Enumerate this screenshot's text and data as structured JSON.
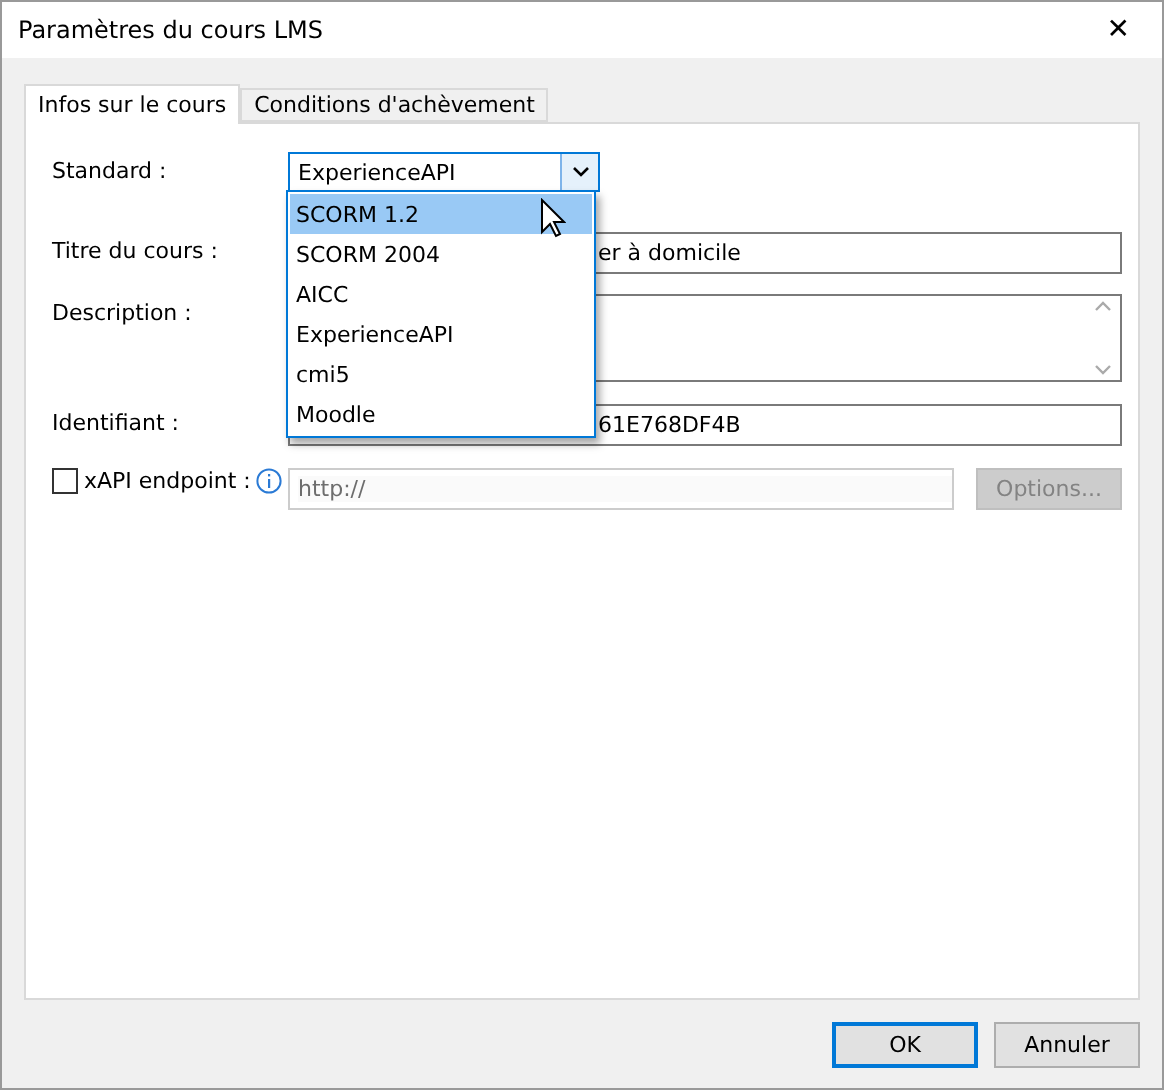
{
  "window": {
    "title": "Paramètres du cours LMS",
    "close": "✕"
  },
  "tabs": [
    {
      "label": "Infos sur le cours",
      "selected": true
    },
    {
      "label": "Conditions d'achèvement",
      "selected": false
    }
  ],
  "standard": {
    "label": "Standard :",
    "value": "ExperienceAPI",
    "expanded": true,
    "options": [
      {
        "label": "SCORM 1.2",
        "highlighted": true
      },
      {
        "label": "SCORM 2004",
        "highlighted": false
      },
      {
        "label": "AICC",
        "highlighted": false
      },
      {
        "label": "ExperienceAPI",
        "highlighted": false
      },
      {
        "label": "cmi5",
        "highlighted": false
      },
      {
        "label": "Moodle",
        "highlighted": false
      }
    ]
  },
  "title_field": {
    "label": "Titre du cours :",
    "value": "er à domicile"
  },
  "description": {
    "label": "Description :"
  },
  "identifier": {
    "label": "Identifiant :",
    "value": "61E768DF4B"
  },
  "xapi": {
    "label": "xAPI endpoint :",
    "checked": false,
    "placeholder": "http://",
    "options_button": "Options...",
    "options_disabled": true
  },
  "buttons": [
    {
      "label": "OK",
      "default": true
    },
    {
      "label": "Annuler",
      "default": false
    }
  ]
}
